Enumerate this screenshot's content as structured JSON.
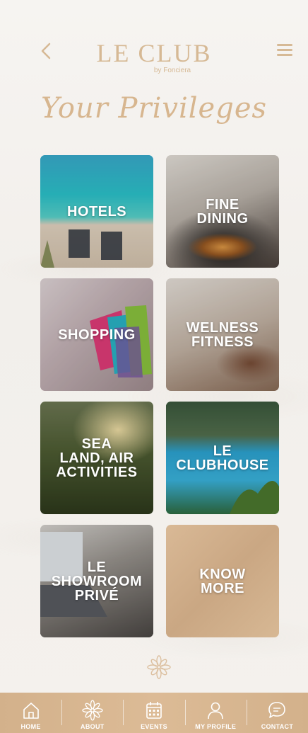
{
  "header": {
    "logo_text": "LE CLUB",
    "logo_sub": "by Fonciera",
    "back_icon": "chevron-left-icon",
    "menu_icon": "hamburger-menu-icon"
  },
  "title": "Your Privileges",
  "tiles": [
    {
      "label": "HOTELS"
    },
    {
      "label": "FINE\nDINING"
    },
    {
      "label": "SHOPPING"
    },
    {
      "label": "WELNESS\nFITNESS"
    },
    {
      "label": "SEA\nLAND, AIR\nACTIVITIES"
    },
    {
      "label": "LE\nCLUBHOUSE"
    },
    {
      "label": "LE\nSHOWROOM\nPRIVÉ"
    },
    {
      "label": "KNOW\nMORE"
    }
  ],
  "tabbar": {
    "items": [
      {
        "label": "HOME",
        "icon": "home-icon"
      },
      {
        "label": "ABOUT",
        "icon": "flower-icon"
      },
      {
        "label": "EVENTS",
        "icon": "calendar-icon"
      },
      {
        "label": "MY PROFILE",
        "icon": "user-icon"
      },
      {
        "label": "CONTACT",
        "icon": "chat-icon"
      }
    ]
  },
  "colors": {
    "accent": "#d6b995",
    "tabbar": "#d8b690",
    "background": "#f4f1ed"
  }
}
